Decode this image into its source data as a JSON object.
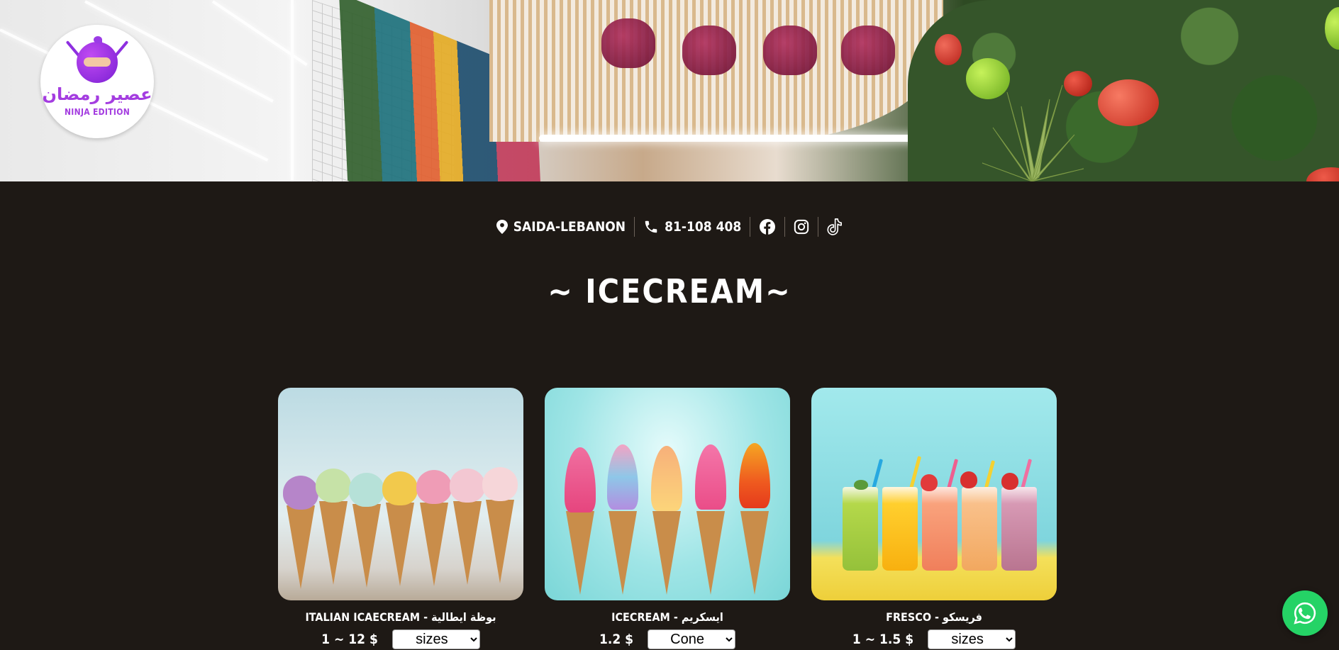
{
  "logo": {
    "arabic_name": "عصير رمضان",
    "edition": "NINJA EDITION"
  },
  "contact": {
    "location": "SAIDA-LEBANON",
    "phone": "81-108 408",
    "icons": [
      "location-pin-icon",
      "phone-icon",
      "facebook-icon",
      "instagram-icon",
      "tiktok-icon"
    ]
  },
  "section": {
    "title": "~ ICECREAM~"
  },
  "products": [
    {
      "name": "ITALIAN ICAECREAM - بوظة ايطالية",
      "price": "1 ~ 12 $",
      "select_value": "sizes"
    },
    {
      "name": "ICECREAM - ايسكريم",
      "price": "1.2 $",
      "select_value": "Cone"
    },
    {
      "name": "FRESCO - فريسكو",
      "price": "1 ~ 1.5 $",
      "select_value": "sizes"
    }
  ],
  "colors": {
    "background": "#1e1915",
    "brand_purple": "#a43de0",
    "whatsapp_green": "#25d366"
  }
}
